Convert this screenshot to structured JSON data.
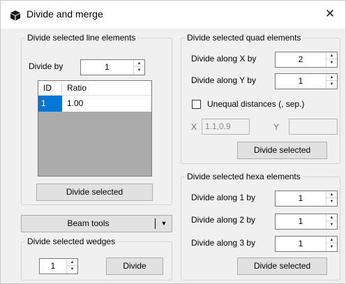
{
  "window": {
    "title": "Divide and merge",
    "close": "✕"
  },
  "line_group": {
    "legend": "Divide selected line elements",
    "divide_by_label": "Divide by",
    "divide_by_value": "1",
    "table": {
      "headers": [
        "ID",
        "Ratio"
      ],
      "rows": [
        {
          "id": "1",
          "ratio": "1.00"
        }
      ]
    },
    "divide_button": "Divide selected"
  },
  "beam_tools": {
    "label": "Beam tools",
    "arrow": "▼"
  },
  "wedge_group": {
    "legend": "Divide selected wedges",
    "value": "1",
    "divide_button": "Divide"
  },
  "quad_group": {
    "legend": "Divide selected quad elements",
    "x_label": "Divide along X by",
    "x_value": "2",
    "y_label": "Divide along Y by",
    "y_value": "1",
    "unequal_label": "Unequal distances (, sep.)",
    "unequal_checked": false,
    "x_field_label": "X",
    "x_field_value": "1.1,0.9",
    "y_field_label": "Y",
    "y_field_value": "",
    "divide_button": "Divide selected"
  },
  "hexa_group": {
    "legend": "Divide selected hexa elements",
    "d1_label": "Divide along 1 by",
    "d1_value": "1",
    "d2_label": "Divide along 2 by",
    "d2_value": "1",
    "d3_label": "Divide along 3 by",
    "d3_value": "1",
    "divide_button": "Divide selected"
  },
  "spinner_arrows": {
    "up": "▲",
    "down": "▼"
  },
  "colors": {
    "selection": "#0078d7",
    "title_bg": "#ffffff",
    "dialog_bg": "#f0f0f0"
  },
  "icons": {
    "app": "cube-icon",
    "close": "close-icon"
  }
}
